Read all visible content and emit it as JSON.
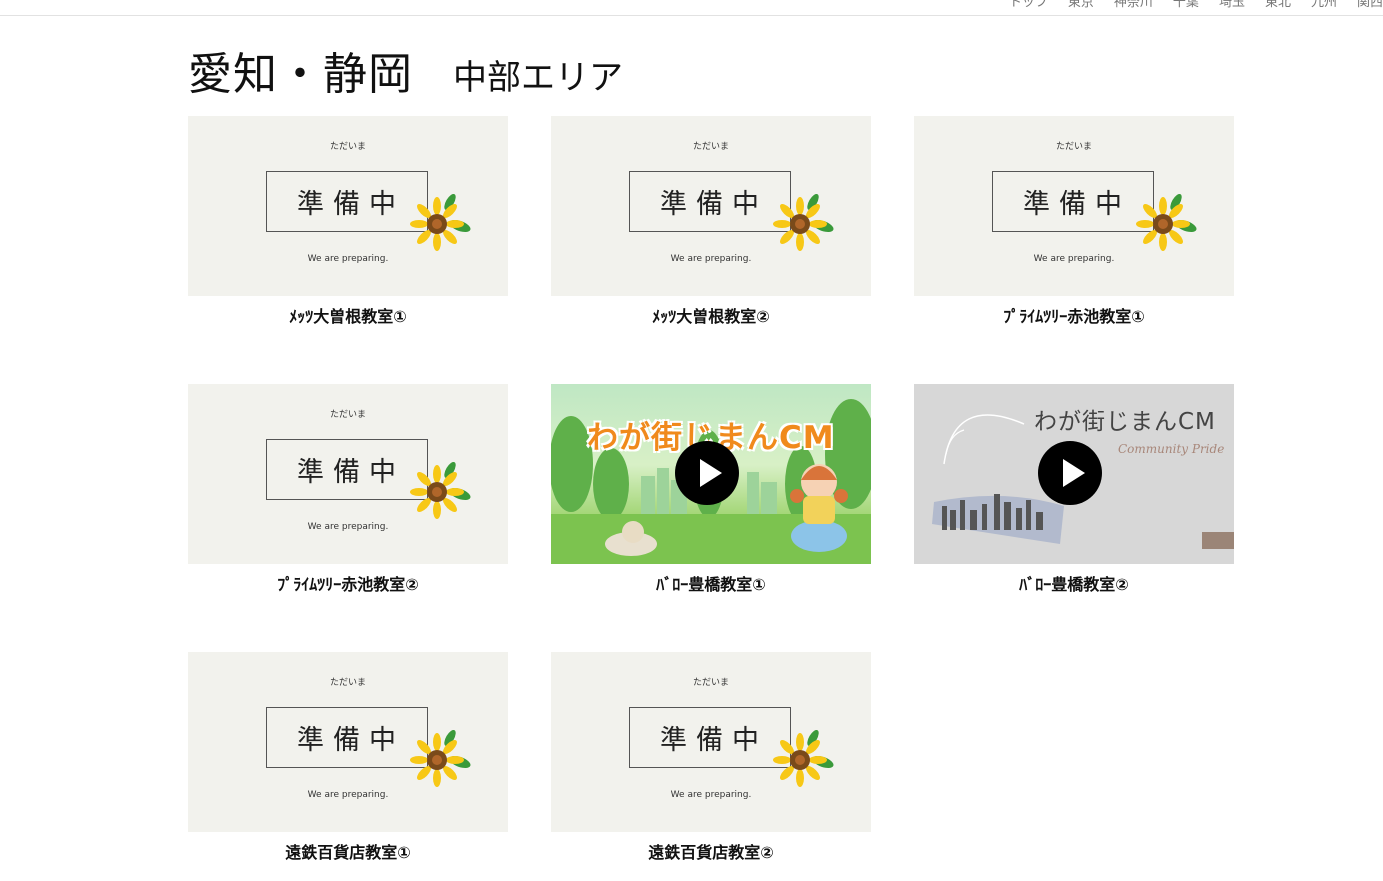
{
  "nav": {
    "items": [
      "トップ",
      "東京",
      "神奈川",
      "千葉",
      "埼玉",
      "東北",
      "九州",
      "関西"
    ]
  },
  "page": {
    "title": "愛知・静岡",
    "subtitle": "中部エリア"
  },
  "placeholder": {
    "top_text": "ただいま",
    "main_text": "準備中",
    "bottom_text": "We are preparing."
  },
  "video": {
    "cm1_title": "わが街じまんCM",
    "cm2_title": "わが街じまんCM",
    "cm2_sub": "Community Pride"
  },
  "cards": [
    {
      "caption": "ﾒｯﾂ大曽根教室①",
      "type": "preparing"
    },
    {
      "caption": "ﾒｯﾂ大曽根教室②",
      "type": "preparing"
    },
    {
      "caption": "ﾌﾟﾗｲﾑﾂﾘｰ赤池教室①",
      "type": "preparing"
    },
    {
      "caption": "ﾌﾟﾗｲﾑﾂﾘｰ赤池教室②",
      "type": "preparing"
    },
    {
      "caption": "ﾊﾞﾛｰ豊橋教室①",
      "type": "video"
    },
    {
      "caption": "ﾊﾞﾛｰ豊橋教室②",
      "type": "video"
    },
    {
      "caption": "遠鉄百貨店教室①",
      "type": "preparing"
    },
    {
      "caption": "遠鉄百貨店教室②",
      "type": "preparing"
    }
  ],
  "colors": {
    "placeholder_bg": "#f2f2ed",
    "sunflower_petal": "#f7c816",
    "sunflower_center": "#7a4a1a",
    "leaf": "#3a9a3a",
    "cm_title": "#f08a1c"
  }
}
